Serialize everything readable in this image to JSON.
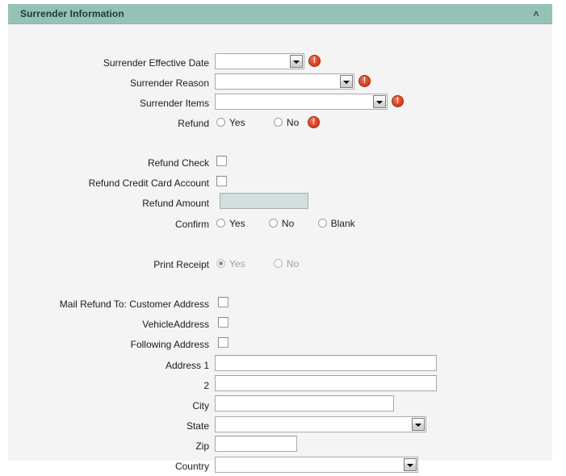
{
  "panel": {
    "title": "Surrender Information",
    "collapse_icon": "chevron-up-icon",
    "collapse_glyph": "˄"
  },
  "colors": {
    "header_bg": "#94c2b6",
    "panel_bg": "#f4f4f4",
    "error_icon": "#d8441f",
    "readonly_field_bg": "#d3dfdd",
    "page_bg": "#ffffff"
  },
  "fields": {
    "surrender_effective_date": {
      "label": "Surrender Effective Date",
      "value": "",
      "type": "combo",
      "has_error": true
    },
    "surrender_reason": {
      "label": "Surrender Reason",
      "value": "",
      "type": "combo",
      "has_error": true
    },
    "surrender_items": {
      "label": "Surrender Items",
      "value": "",
      "type": "combo",
      "has_error": true
    },
    "refund": {
      "label": "Refund",
      "has_error": true,
      "options": [
        {
          "label": "Yes",
          "checked": false
        },
        {
          "label": "No",
          "checked": false
        }
      ]
    },
    "refund_check": {
      "label": "Refund Check",
      "checked": false
    },
    "refund_credit_card_account": {
      "label": "Refund Credit Card Account",
      "checked": false
    },
    "refund_amount": {
      "label": "Refund Amount",
      "value": "",
      "readonly": true
    },
    "confirm": {
      "label": "Confirm",
      "options": [
        {
          "label": "Yes",
          "checked": false
        },
        {
          "label": "No",
          "checked": false
        },
        {
          "label": "Blank",
          "checked": false
        }
      ]
    },
    "print_receipt": {
      "label": "Print Receipt",
      "disabled": true,
      "options": [
        {
          "label": "Yes",
          "checked": true
        },
        {
          "label": "No",
          "checked": false
        }
      ]
    },
    "mail_refund_to": {
      "label": "Mail Refund To:",
      "customer_address": {
        "label": "Customer Address",
        "checked": false
      },
      "vehicle_address": {
        "label": "VehicleAddress",
        "checked": false
      },
      "following_address": {
        "label": "Following Address",
        "checked": false
      }
    },
    "address1": {
      "label": "Address 1",
      "value": ""
    },
    "address2": {
      "label": "2",
      "value": ""
    },
    "city": {
      "label": "City",
      "value": ""
    },
    "state": {
      "label": "State",
      "value": "",
      "type": "combo"
    },
    "zip": {
      "label": "Zip",
      "value": ""
    },
    "country": {
      "label": "Country",
      "value": "",
      "type": "combo"
    }
  }
}
